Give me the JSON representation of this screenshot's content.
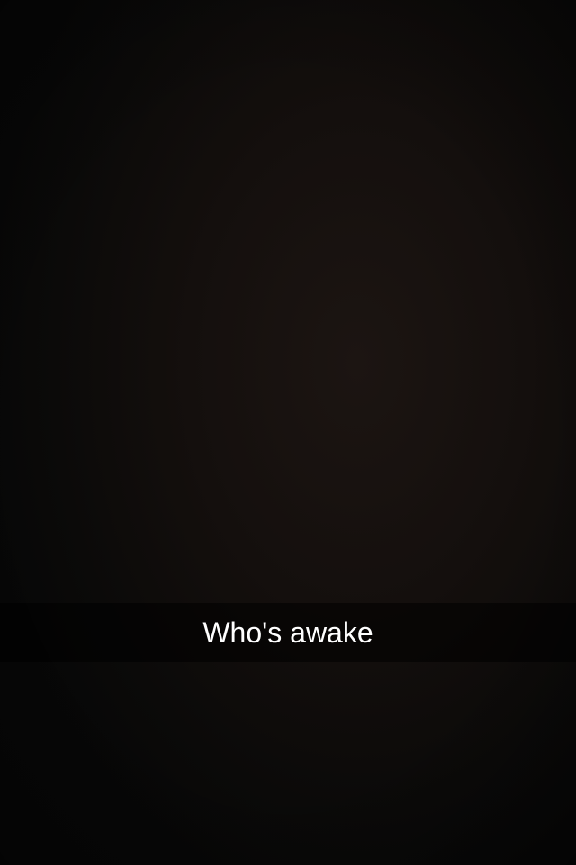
{
  "snap": {
    "caption": "Who's awake"
  },
  "colors": {
    "background": "#0a0908",
    "caption_bar": "#000000",
    "caption_text": "#ffffff"
  }
}
